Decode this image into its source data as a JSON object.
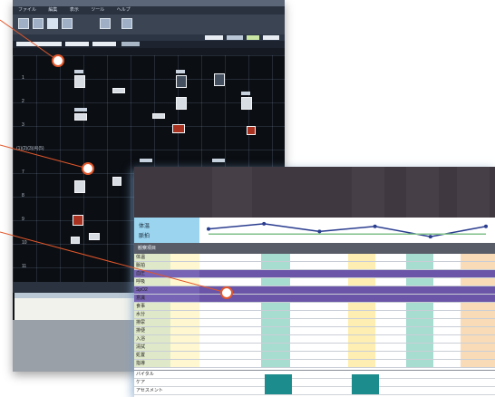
{
  "back_window": {
    "menu_items": [
      "ファイル",
      "編集",
      "表示",
      "ツール",
      "ヘルプ"
    ],
    "row_labels": [
      "病棟",
      "1",
      "2",
      "3",
      "(1)(2)(3)(4)(5)",
      "6",
      "7",
      "8",
      "9",
      "10",
      "11"
    ]
  },
  "front_window": {
    "chart_series": [
      {
        "name": "体温",
        "color": "#2a3d8f",
        "values": [
          37.8,
          38.0,
          37.7,
          37.9,
          37.5,
          37.9
        ]
      },
      {
        "name": "脈拍",
        "color": "#7fc08a",
        "values": [
          37.6,
          37.6,
          37.6,
          37.6,
          37.6,
          37.6
        ]
      }
    ],
    "table_header_label": "観察項目",
    "row_labels": [
      "体温",
      "脈拍",
      "血圧",
      "呼吸",
      "SpO2",
      "意識",
      "食事",
      "水分",
      "排尿",
      "排便",
      "入浴",
      "清拭",
      "処置",
      "指導"
    ],
    "footer_labels": [
      "バイタル",
      "ケア",
      "アセスメント"
    ]
  },
  "colors": {
    "callout": "#e2572b",
    "dark_bg": "#111419",
    "purple_row": "#6a55a8",
    "teal_cell": "#1c8c8c"
  }
}
